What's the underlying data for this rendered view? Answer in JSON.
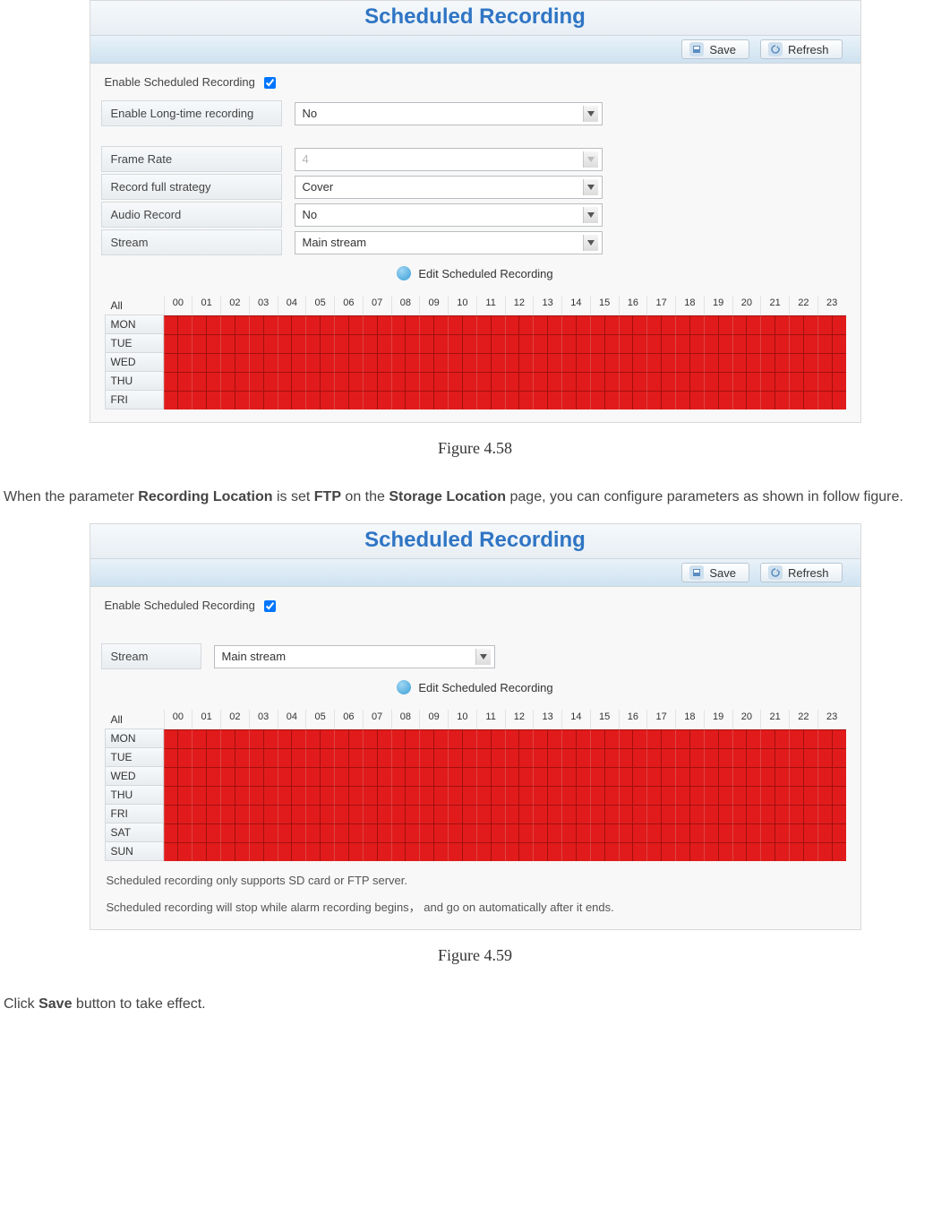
{
  "figures": {
    "f1_caption": "Figure 4.58",
    "f2_caption": "Figure 4.59"
  },
  "prose": {
    "p1_a": "When the parameter ",
    "p1_b": "Recording Location",
    "p1_c": " is set ",
    "p1_d": "FTP",
    "p1_e": " on the ",
    "p1_f": "Storage Location",
    "p1_g": " page, you can configure parameters as shown in follow figure.",
    "p2_a": "Click ",
    "p2_b": "Save",
    "p2_c": " button to take effect."
  },
  "panel_common": {
    "title": "Scheduled Recording",
    "save_label": "Save",
    "refresh_label": "Refresh",
    "enable_label": "Enable Scheduled Recording",
    "edit_link": "Edit Scheduled Recording"
  },
  "panel1_fields": {
    "longtime_label": "Enable Long-time recording",
    "longtime_value": "No",
    "framerate_label": "Frame Rate",
    "framerate_value": "4",
    "fullstrategy_label": "Record full strategy",
    "fullstrategy_value": "Cover",
    "audio_label": "Audio Record",
    "audio_value": "No",
    "stream_label": "Stream",
    "stream_value": "Main stream"
  },
  "panel2_fields": {
    "stream_label": "Stream",
    "stream_value": "Main stream"
  },
  "schedule": {
    "all_label": "All",
    "hours": [
      "00",
      "01",
      "02",
      "03",
      "04",
      "05",
      "06",
      "07",
      "08",
      "09",
      "10",
      "11",
      "12",
      "13",
      "14",
      "15",
      "16",
      "17",
      "18",
      "19",
      "20",
      "21",
      "22",
      "23"
    ],
    "days_short": [
      "MON",
      "TUE",
      "WED",
      "THU",
      "FRI"
    ],
    "days_full": [
      "MON",
      "TUE",
      "WED",
      "THU",
      "FRI",
      "SAT",
      "SUN"
    ]
  },
  "notes": {
    "n1": "Scheduled recording only supports SD card or FTP server.",
    "n2": "Scheduled recording will stop while alarm recording begins， and go on automatically after it ends."
  }
}
